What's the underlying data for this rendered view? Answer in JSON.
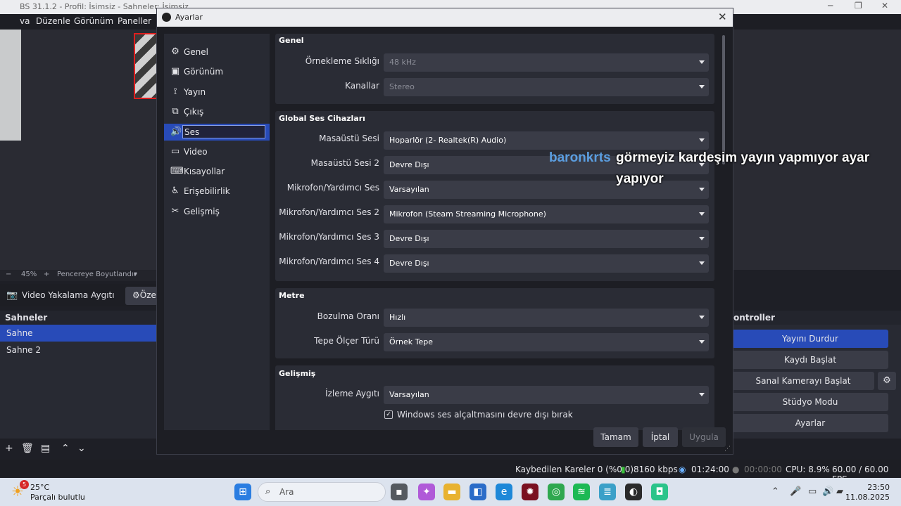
{
  "obs": {
    "title": "BS 31.1.2 - Profil: İsimsiz - Sahneler: İsimsiz",
    "menu": [
      "va",
      "Düzenle",
      "Görünüm",
      "Paneller"
    ],
    "zoom": "45%",
    "zoom_mode": "Pencereye Boyutlandır",
    "source_label": "Video Yakalama Aygıtı",
    "source_button": "Öze",
    "scenes_header": "Sahneler",
    "scenes": [
      "Sahne",
      "Sahne 2"
    ],
    "controls_header": "ontroller",
    "controls": [
      "Yayını Durdur",
      "Kaydı Başlat",
      "Sanal Kamerayı Başlat",
      "Stüdyo Modu",
      "Ayarlar"
    ],
    "status": {
      "dropped": "Kaybedilen Kareler 0 (%0.0)",
      "bitrate": "8160 kbps",
      "stream_time": "01:24:00",
      "rec_time": "00:00:00",
      "cpu": "CPU: 8.9%",
      "fps": "60.00 / 60.00 FPS"
    }
  },
  "dialog": {
    "title": "Ayarlar",
    "nav": [
      {
        "icon": "gear-icon",
        "label": "Genel"
      },
      {
        "icon": "monitor-icon",
        "label": "Görünüm"
      },
      {
        "icon": "broadcast-icon",
        "label": "Yayın"
      },
      {
        "icon": "output-icon",
        "label": "Çıkış"
      },
      {
        "icon": "speaker-icon",
        "label": "Ses"
      },
      {
        "icon": "display-icon",
        "label": "Video"
      },
      {
        "icon": "keyboard-icon",
        "label": "Kısayollar"
      },
      {
        "icon": "accessibility-icon",
        "label": "Erişebilirlik"
      },
      {
        "icon": "tools-icon",
        "label": "Gelişmiş"
      }
    ],
    "active_nav": "Ses",
    "sections": {
      "genel": {
        "title": "Genel",
        "rows": [
          {
            "label": "Örnekleme Sıklığı",
            "value": "48 kHz",
            "disabled": true
          },
          {
            "label": "Kanallar",
            "value": "Stereo",
            "disabled": true
          }
        ]
      },
      "global": {
        "title": "Global Ses Cihazları",
        "rows": [
          {
            "label": "Masaüstü Sesi",
            "value": "Hoparlör (2- Realtek(R) Audio)"
          },
          {
            "label": "Masaüstü Sesi 2",
            "value": "Devre Dışı"
          },
          {
            "label": "Mikrofon/Yardımcı Ses",
            "value": "Varsayılan"
          },
          {
            "label": "Mikrofon/Yardımcı Ses 2",
            "value": "Mikrofon (Steam Streaming Microphone)"
          },
          {
            "label": "Mikrofon/Yardımcı Ses 3",
            "value": "Devre Dışı"
          },
          {
            "label": "Mikrofon/Yardımcı Ses 4",
            "value": "Devre Dışı"
          }
        ]
      },
      "metre": {
        "title": "Metre",
        "rows": [
          {
            "label": "Bozulma Oranı",
            "value": "Hızlı"
          },
          {
            "label": "Tepe Ölçer Türü",
            "value": "Örnek Tepe"
          }
        ]
      },
      "gelismis": {
        "title": "Gelişmiş",
        "rows": [
          {
            "label": "İzleme Aygıtı",
            "value": "Varsayılan"
          }
        ],
        "checkbox": {
          "label": "Windows ses alçaltmasını devre dışı bırak",
          "checked": true
        }
      }
    },
    "buttons": {
      "ok": "Tamam",
      "cancel": "İptal",
      "apply": "Uygula"
    }
  },
  "chat": {
    "user": "baronkrts",
    "message": "görmeyiz kardeşim yayın yapmıyor ayar yapıyor"
  },
  "taskbar": {
    "weather_temp": "25°C",
    "weather_desc": "Parçalı bulutlu",
    "weather_badge": "5",
    "search_placeholder": "Ara",
    "time": "23:50",
    "date": "11.08.2025"
  },
  "colors": {
    "accent": "#284bb8",
    "dialog_bg": "#1d1e24",
    "section_bg": "#2a2c35",
    "combo_bg": "#3a3c47",
    "chat_user": "#5b9ee0"
  }
}
